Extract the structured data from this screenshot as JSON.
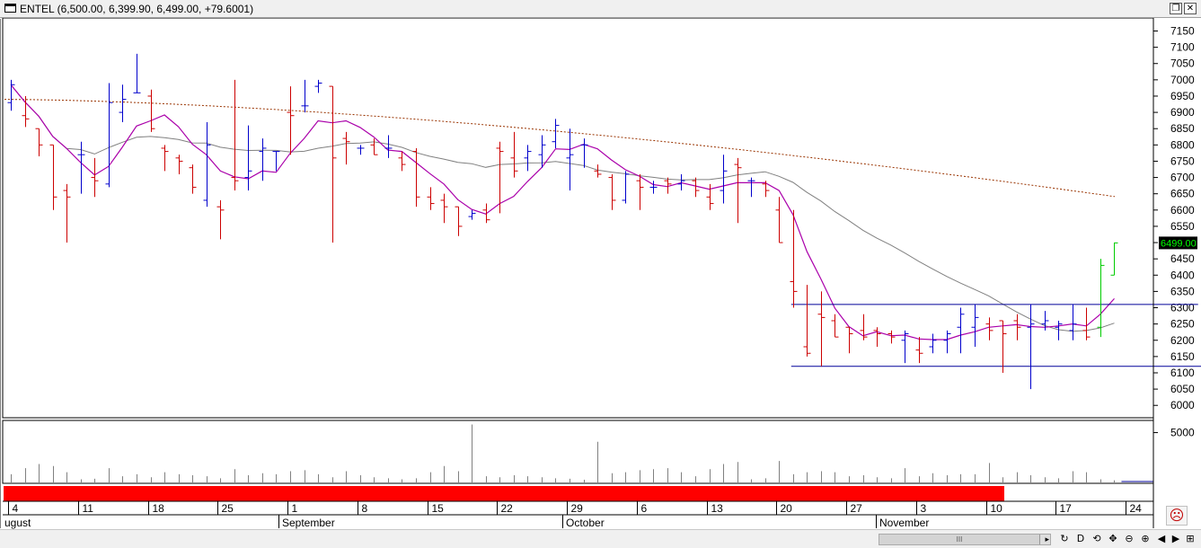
{
  "window": {
    "title": "ENTEL (6,500.00, 6,399.90, 6,499.00, +79.6001)",
    "restore_button": "❐",
    "close_button": "✕"
  },
  "colors": {
    "up_bar": "#0000cc",
    "down_bar": "#cc0000",
    "last_bars": "#00cc00",
    "fast_ma": "#aa00aa",
    "mid_ma": "#808080",
    "slow_ma": "#993300",
    "trendline": "#000099",
    "volume": "#808080",
    "price_tag_bg": "#000000",
    "price_tag_fg": "#00ff00",
    "range_band": "#ff0000"
  },
  "chart_data": {
    "type": "ohlc",
    "symbol": "ENTEL",
    "last_price_label": "6499.00",
    "y_ticks": [
      7150,
      7100,
      7050,
      7000,
      6950,
      6900,
      6850,
      6800,
      6750,
      6700,
      6650,
      6600,
      6550,
      6500,
      6450,
      6400,
      6350,
      6300,
      6250,
      6200,
      6150,
      6100,
      6050,
      6000
    ],
    "ylim": [
      5962,
      7190
    ],
    "volume_tick": "5000",
    "volume_ylim": [
      0,
      6200
    ],
    "x_day_labels": [
      "4",
      "11",
      "18",
      "25",
      "1",
      "8",
      "15",
      "22",
      "29",
      "6",
      "13",
      "20",
      "27",
      "3",
      "10",
      "17",
      "24"
    ],
    "x_month_labels": [
      "ugust",
      "September",
      "October",
      "November"
    ],
    "bars": [
      {
        "date": "Aug-04",
        "o": 6930,
        "h": 7000,
        "l": 6905,
        "c": 6985,
        "v": 900
      },
      {
        "date": "Aug-05",
        "o": 6890,
        "h": 6950,
        "l": 6855,
        "c": 6880,
        "v": 1500
      },
      {
        "date": "Aug-06",
        "o": 6850,
        "h": 6850,
        "l": 6765,
        "c": 6800,
        "v": 1900
      },
      {
        "date": "Aug-07",
        "o": 6800,
        "h": 6800,
        "l": 6600,
        "c": 6640,
        "v": 1700
      },
      {
        "date": "Aug-08",
        "o": 6660,
        "h": 6680,
        "l": 6500,
        "c": 6640,
        "v": 1100
      },
      {
        "date": "Aug-11",
        "o": 6770,
        "h": 6810,
        "l": 6650,
        "c": 6770,
        "v": 400
      },
      {
        "date": "Aug-12",
        "o": 6700,
        "h": 6760,
        "l": 6640,
        "c": 6690,
        "v": 450
      },
      {
        "date": "Aug-13",
        "o": 6680,
        "h": 6990,
        "l": 6670,
        "c": 6930,
        "v": 1500
      },
      {
        "date": "Aug-14",
        "o": 6900,
        "h": 6985,
        "l": 6870,
        "c": 6940,
        "v": 700
      },
      {
        "date": "Aug-15",
        "o": 6960,
        "h": 7080,
        "l": 6960,
        "c": 6960,
        "v": 900
      },
      {
        "date": "Aug-18",
        "o": 6950,
        "h": 6970,
        "l": 6840,
        "c": 6850,
        "v": 600
      },
      {
        "date": "Aug-19",
        "o": 6790,
        "h": 6800,
        "l": 6720,
        "c": 6780,
        "v": 1100
      },
      {
        "date": "Aug-20",
        "o": 6760,
        "h": 6770,
        "l": 6710,
        "c": 6750,
        "v": 900
      },
      {
        "date": "Aug-21",
        "o": 6730,
        "h": 6740,
        "l": 6650,
        "c": 6670,
        "v": 800
      },
      {
        "date": "Aug-22",
        "o": 6630,
        "h": 6870,
        "l": 6610,
        "c": 6800,
        "v": 700
      },
      {
        "date": "Aug-25",
        "o": 6610,
        "h": 6630,
        "l": 6510,
        "c": 6600,
        "v": 500
      },
      {
        "date": "Aug-26",
        "o": 6700,
        "h": 7000,
        "l": 6660,
        "c": 6690,
        "v": 1400
      },
      {
        "date": "Aug-27",
        "o": 6700,
        "h": 6860,
        "l": 6660,
        "c": 6720,
        "v": 800
      },
      {
        "date": "Aug-28",
        "o": 6780,
        "h": 6820,
        "l": 6690,
        "c": 6790,
        "v": 1000
      },
      {
        "date": "Aug-29",
        "o": 6780,
        "h": 6780,
        "l": 6720,
        "c": 6780,
        "v": 900
      },
      {
        "date": "Sep-01",
        "o": 6900,
        "h": 6980,
        "l": 6770,
        "c": 6890,
        "v": 1200
      },
      {
        "date": "Sep-02",
        "o": 6920,
        "h": 7000,
        "l": 6900,
        "c": 6920,
        "v": 1300
      },
      {
        "date": "Sep-03",
        "o": 6980,
        "h": 7000,
        "l": 6960,
        "c": 6990,
        "v": 900
      },
      {
        "date": "Sep-04",
        "o": 6980,
        "h": 6980,
        "l": 6500,
        "c": 6760,
        "v": 600
      },
      {
        "date": "Sep-05",
        "o": 6820,
        "h": 6840,
        "l": 6740,
        "c": 6810,
        "v": 1200
      },
      {
        "date": "Sep-08",
        "o": 6790,
        "h": 6800,
        "l": 6770,
        "c": 6790,
        "v": 800
      },
      {
        "date": "Sep-09",
        "o": 6800,
        "h": 6820,
        "l": 6770,
        "c": 6770,
        "v": 600
      },
      {
        "date": "Sep-10",
        "o": 6790,
        "h": 6830,
        "l": 6760,
        "c": 6790,
        "v": 500
      },
      {
        "date": "Sep-11",
        "o": 6760,
        "h": 6780,
        "l": 6720,
        "c": 6740,
        "v": 400
      },
      {
        "date": "Sep-12",
        "o": 6780,
        "h": 6790,
        "l": 6610,
        "c": 6640,
        "v": 500
      },
      {
        "date": "Sep-15",
        "o": 6640,
        "h": 6670,
        "l": 6600,
        "c": 6620,
        "v": 1100
      },
      {
        "date": "Sep-16",
        "o": 6630,
        "h": 6650,
        "l": 6560,
        "c": 6610,
        "v": 1700
      },
      {
        "date": "Sep-17",
        "o": 6610,
        "h": 6610,
        "l": 6520,
        "c": 6550,
        "v": 1200
      },
      {
        "date": "Sep-18",
        "o": 6580,
        "h": 6600,
        "l": 6570,
        "c": 6590,
        "v": 5800
      },
      {
        "date": "Sep-19",
        "o": 6600,
        "h": 6620,
        "l": 6560,
        "c": 6570,
        "v": 700
      },
      {
        "date": "Sep-22",
        "o": 6790,
        "h": 6810,
        "l": 6590,
        "c": 6780,
        "v": 600
      },
      {
        "date": "Sep-23",
        "o": 6760,
        "h": 6840,
        "l": 6700,
        "c": 6720,
        "v": 800
      },
      {
        "date": "Sep-24",
        "o": 6760,
        "h": 6800,
        "l": 6720,
        "c": 6780,
        "v": 700
      },
      {
        "date": "Sep-25",
        "o": 6770,
        "h": 6830,
        "l": 6730,
        "c": 6800,
        "v": 600
      },
      {
        "date": "Sep-26",
        "o": 6810,
        "h": 6880,
        "l": 6790,
        "c": 6860,
        "v": 500
      },
      {
        "date": "Sep-29",
        "o": 6760,
        "h": 6850,
        "l": 6660,
        "c": 6770,
        "v": 450
      },
      {
        "date": "Sep-30",
        "o": 6800,
        "h": 6820,
        "l": 6730,
        "c": 6800,
        "v": 350
      },
      {
        "date": "Oct-01",
        "o": 6720,
        "h": 6740,
        "l": 6700,
        "c": 6710,
        "v": 4100
      },
      {
        "date": "Oct-02",
        "o": 6700,
        "h": 6710,
        "l": 6600,
        "c": 6630,
        "v": 1000
      },
      {
        "date": "Oct-03",
        "o": 6630,
        "h": 6720,
        "l": 6620,
        "c": 6710,
        "v": 1100
      },
      {
        "date": "Oct-06",
        "o": 6690,
        "h": 6710,
        "l": 6600,
        "c": 6670,
        "v": 1300
      },
      {
        "date": "Oct-07",
        "o": 6670,
        "h": 6690,
        "l": 6650,
        "c": 6670,
        "v": 1400
      },
      {
        "date": "Oct-08",
        "o": 6690,
        "h": 6700,
        "l": 6650,
        "c": 6680,
        "v": 1500
      },
      {
        "date": "Oct-09",
        "o": 6680,
        "h": 6710,
        "l": 6660,
        "c": 6690,
        "v": 1100
      },
      {
        "date": "Oct-10",
        "o": 6690,
        "h": 6700,
        "l": 6640,
        "c": 6660,
        "v": 700
      },
      {
        "date": "Oct-13",
        "o": 6640,
        "h": 6680,
        "l": 6600,
        "c": 6620,
        "v": 1400
      },
      {
        "date": "Oct-14",
        "o": 6660,
        "h": 6770,
        "l": 6620,
        "c": 6720,
        "v": 1900
      },
      {
        "date": "Oct-15",
        "o": 6740,
        "h": 6760,
        "l": 6560,
        "c": 6730,
        "v": 2100
      },
      {
        "date": "Oct-16",
        "o": 6690,
        "h": 6700,
        "l": 6640,
        "c": 6690,
        "v": 400
      },
      {
        "date": "Oct-17",
        "o": 6680,
        "h": 6690,
        "l": 6640,
        "c": 6660,
        "v": 500
      },
      {
        "date": "Oct-20",
        "o": 6600,
        "h": 6640,
        "l": 6500,
        "c": 6500,
        "v": 2200
      },
      {
        "date": "Oct-21",
        "o": 6380,
        "h": 6600,
        "l": 6300,
        "c": 6350,
        "v": 900
      },
      {
        "date": "Oct-22",
        "o": 6180,
        "h": 6370,
        "l": 6150,
        "c": 6160,
        "v": 1100
      },
      {
        "date": "Oct-23",
        "o": 6280,
        "h": 6350,
        "l": 6120,
        "c": 6270,
        "v": 1200
      },
      {
        "date": "Oct-24",
        "o": 6260,
        "h": 6280,
        "l": 6210,
        "c": 6210,
        "v": 1100
      },
      {
        "date": "Oct-27",
        "o": 6240,
        "h": 6240,
        "l": 6160,
        "c": 6220,
        "v": 700
      },
      {
        "date": "Oct-28",
        "o": 6230,
        "h": 6280,
        "l": 6200,
        "c": 6210,
        "v": 800
      },
      {
        "date": "Oct-29",
        "o": 6230,
        "h": 6240,
        "l": 6180,
        "c": 6220,
        "v": 600
      },
      {
        "date": "Oct-30",
        "o": 6220,
        "h": 6230,
        "l": 6190,
        "c": 6210,
        "v": 500
      },
      {
        "date": "Oct-31",
        "o": 6200,
        "h": 6230,
        "l": 6130,
        "c": 6220,
        "v": 1500
      },
      {
        "date": "Nov-03",
        "o": 6170,
        "h": 6210,
        "l": 6130,
        "c": 6160,
        "v": 700
      },
      {
        "date": "Nov-04",
        "o": 6180,
        "h": 6220,
        "l": 6160,
        "c": 6200,
        "v": 1000
      },
      {
        "date": "Nov-05",
        "o": 6200,
        "h": 6230,
        "l": 6160,
        "c": 6220,
        "v": 800
      },
      {
        "date": "Nov-06",
        "o": 6240,
        "h": 6300,
        "l": 6160,
        "c": 6280,
        "v": 900
      },
      {
        "date": "Nov-07",
        "o": 6240,
        "h": 6310,
        "l": 6180,
        "c": 6270,
        "v": 900
      },
      {
        "date": "Nov-10",
        "o": 6250,
        "h": 6270,
        "l": 6200,
        "c": 6230,
        "v": 2000
      },
      {
        "date": "Nov-11",
        "o": 6260,
        "h": 6260,
        "l": 6100,
        "c": 6220,
        "v": 600
      },
      {
        "date": "Nov-12",
        "o": 6260,
        "h": 6280,
        "l": 6200,
        "c": 6240,
        "v": 1100
      },
      {
        "date": "Nov-13",
        "o": 6240,
        "h": 6310,
        "l": 6050,
        "c": 6250,
        "v": 800
      },
      {
        "date": "Nov-14",
        "o": 6250,
        "h": 6290,
        "l": 6230,
        "c": 6260,
        "v": 600
      },
      {
        "date": "Nov-17",
        "o": 6240,
        "h": 6260,
        "l": 6200,
        "c": 6250,
        "v": 500
      },
      {
        "date": "Nov-18",
        "o": 6230,
        "h": 6310,
        "l": 6200,
        "c": 6250,
        "v": 1200
      },
      {
        "date": "Nov-19",
        "o": 6230,
        "h": 6300,
        "l": 6200,
        "c": 6210,
        "v": 1100
      },
      {
        "date": "Nov-20",
        "o": 6240,
        "h": 6450,
        "l": 6210,
        "c": 6430,
        "v": 400
      },
      {
        "date": "Nov-21",
        "o": 6400,
        "h": 6500,
        "l": 6400,
        "c": 6499,
        "v": 300
      }
    ],
    "trendlines": [
      {
        "name": "resistance",
        "start": "Oct-21",
        "end": "Nov-29",
        "value": 6310
      },
      {
        "name": "support",
        "start": "Oct-21",
        "end": "Dec-02",
        "value": 6120
      }
    ]
  },
  "statusbar": {
    "scroll_thumb": "III",
    "buttons": [
      "↻",
      "D",
      "⟲",
      "✥",
      "⊖",
      "⊕",
      "◀",
      "▶",
      "⊞"
    ]
  },
  "sad_face": "☹"
}
